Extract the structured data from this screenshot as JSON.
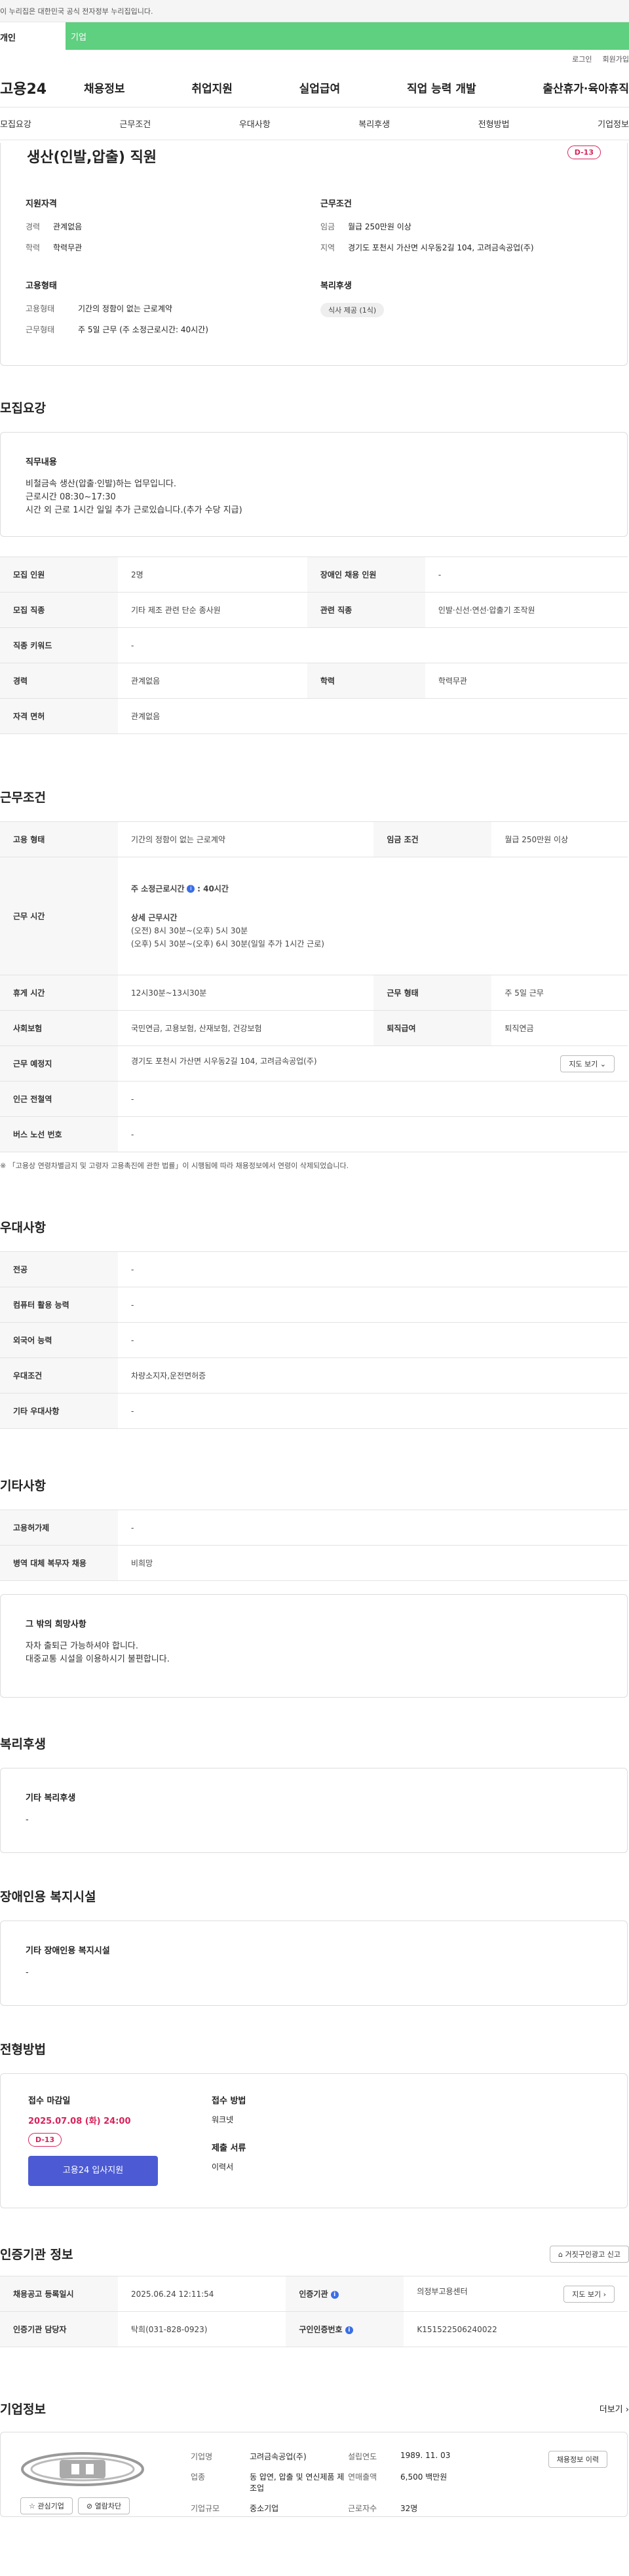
{
  "notice": "이 누리집은 대한민국 공식 전자정부 누리집입니다.",
  "usertype": {
    "personal": "개인",
    "corporate": "기업"
  },
  "toplinks": {
    "login": "로그인",
    "join": "회원가입"
  },
  "gnb": {
    "logo": "고용24",
    "menu": [
      "채용정보",
      "취업지원",
      "실업급여",
      "직업 능력 개발",
      "출산휴가·육아휴직"
    ]
  },
  "tabs": [
    "모집요강",
    "근무조건",
    "우대사항",
    "복리후생",
    "전형방법",
    "기업정보"
  ],
  "job": {
    "title": "생산(인발,압출) 직원",
    "dday": "D-13"
  },
  "summary": {
    "qual_title": "지원자격",
    "career_k": "경력",
    "career_v": "관계없음",
    "edu_k": "학력",
    "edu_v": "학력무관",
    "cond_title": "근무조건",
    "wage_k": "임금",
    "wage_v": "월급 250만원 이상",
    "area_k": "지역",
    "area_v": "경기도 포천시 가산면 시우동2길 104, 고려금속공업(주)",
    "emp_title": "고용형태",
    "emptype_k": "고용형태",
    "emptype_v": "기간의 정함이 없는 근로계약",
    "worktype_k": "근무형태",
    "worktype_v": "주 5일 근무 (주 소정근로시간: 40시간)",
    "welfare_title": "복리후생",
    "welfare_pill": "식사 제공 (1식)"
  },
  "recruit": {
    "title": "모집요강",
    "duty_title": "직무내용",
    "duty_l1": "비철금속 생산(압출·인발)하는 업무입니다.",
    "duty_l2": "근로시간 08:30~17:30",
    "duty_l3": "시간 외 근로 1시간 일일 추가 근로있습니다.(추가 수당 지급)",
    "r1": [
      "모집 인원",
      "2명",
      "장애인 채용 인원",
      "-"
    ],
    "r2": [
      "모집 직종",
      "기타 제조 관련 단순 종사원",
      "관련 직종",
      "인발·신선·연선·압출기 조작원"
    ],
    "r3": [
      "직종 키워드",
      "-"
    ],
    "r4": [
      "경력",
      "관계없음",
      "학력",
      "학력무관"
    ],
    "r5": [
      "자격 면허",
      "관계없음"
    ]
  },
  "work": {
    "title": "근무조건",
    "r1": [
      "고용 형태",
      "기간의 정함이 없는 근로계약",
      "임금 조건",
      "월급 250만원 이상"
    ],
    "hours_k": "근무 시간",
    "hours_main": "주 소정근로시간",
    "hours_main_v": ": 40시간",
    "hours_detail": "상세 근무시간",
    "hours_l1": "(오전) 8시 30분~(오후) 5시 30분",
    "hours_l2": "(오후) 5시 30분~(오후) 6시 30분(일일 추가 1시간 근로)",
    "r3": [
      "휴게 시간",
      "12시30분~13시30분",
      "근무 형태",
      "주 5일 근무"
    ],
    "r4": [
      "사회보험",
      "국민연금, 고용보험, 산재보험, 건강보험",
      "퇴직급여",
      "퇴직연금"
    ],
    "r5": [
      "근무 예정지",
      "경기도 포천시 가산면 시우동2길 104, 고려금속공업(주)"
    ],
    "map_btn": "지도 보기",
    "r6": [
      "인근 전철역",
      "-"
    ],
    "r7": [
      "버스 노선 번호",
      "-"
    ],
    "note": "※ 「고용상 연령차별금지 및 고령자 고용촉진에 관한 법률」이 시행됨에 따라 채용정보에서 연령이 삭제되었습니다."
  },
  "pref": {
    "title": "우대사항",
    "rows": [
      [
        "전공",
        "-"
      ],
      [
        "컴퓨터 활용 능력",
        "-"
      ],
      [
        "외국어 능력",
        "-"
      ],
      [
        "우대조건",
        "차량소지자,운전면허증"
      ],
      [
        "기타 우대사항",
        "-"
      ]
    ]
  },
  "etc": {
    "title": "기타사항",
    "rows": [
      [
        "고용허가제",
        "-"
      ],
      [
        "병역 대체 복무자 채용",
        "비희망"
      ]
    ],
    "wish_title": "그 밖의 희망사항",
    "wish_l1": "자차 출퇴근 가능하셔야 합니다.",
    "wish_l2": "대중교통 시설을 이용하시기 불편합니다."
  },
  "welfare": {
    "title": "복리후생",
    "sub": "기타 복리후생",
    "val": "-"
  },
  "disab": {
    "title": "장애인용 복지시설",
    "sub": "기타 장애인용 복지시설",
    "val": "-"
  },
  "process": {
    "title": "전형방법",
    "deadline_title": "접수 마감일",
    "deadline": "2025.07.08 (화) 24:00",
    "dday": "D-13",
    "apply_btn": "고용24 입사지원",
    "method_title": "접수 방법",
    "method": "워크넷",
    "docs_title": "제출 서류",
    "docs": "이력서"
  },
  "cert": {
    "title": "인증기관 정보",
    "report_btn": "거짓구인광고 신고",
    "r1": [
      "채용공고 등록일시",
      "2025.06.24 12:11:54",
      "인증기관",
      "의정부고용센터"
    ],
    "detail_btn": "지도 보기",
    "r2": [
      "인증기관 담당자",
      "탁희(031-828-0923)",
      "구인인증번호",
      "K151522506240022"
    ]
  },
  "corp": {
    "title": "기업정보",
    "more": "더보기",
    "fav_btn": "관심기업",
    "block_btn": "열람차단",
    "name_k": "기업명",
    "name_v": "고려금속공업(주)",
    "year_k": "설립연도",
    "year_v": "1989. 11. 03",
    "biz_k": "업종",
    "biz_v": "동 압연, 압출 및 연신제품 제조업",
    "sales_k": "연매출액",
    "sales_v": "6,500 백만원",
    "emp_k": "근로자수",
    "emp_v": "32명",
    "size_k": "기업규모",
    "size_v": "중소기업",
    "history_btn": "채용정보 이력"
  },
  "colors": {
    "brand_green": "#5fcf80",
    "dday_red": "#d7245c",
    "apply_blue": "#4c5bd4"
  }
}
